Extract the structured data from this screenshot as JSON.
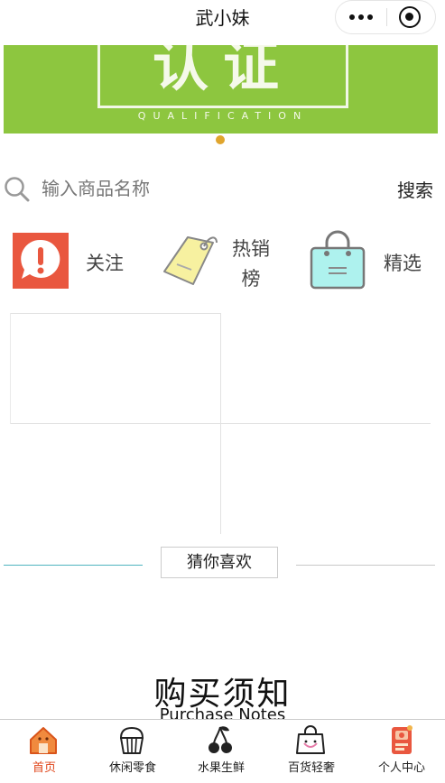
{
  "app": {
    "title": "武小妹"
  },
  "banner": {
    "big_text": "认证",
    "small_text": "QUALIFICATION"
  },
  "search": {
    "placeholder": "输入商品名称",
    "button_label": "搜索"
  },
  "categories": [
    {
      "label": "关注",
      "icon": "alert-bubble-icon"
    },
    {
      "label": "热销\n榜",
      "icon": "price-tag-icon"
    },
    {
      "label": "精选",
      "icon": "shopping-bag-icon"
    }
  ],
  "guess": {
    "label": "猜你喜欢"
  },
  "notes": {
    "title": "购买须知",
    "subtitle": "Purchase Notes"
  },
  "tabbar": {
    "items": [
      {
        "label": "首页",
        "icon": "home-icon",
        "active": true
      },
      {
        "label": "休闲零食",
        "icon": "cupcake-icon",
        "active": false
      },
      {
        "label": "水果生鲜",
        "icon": "cherry-icon",
        "active": false
      },
      {
        "label": "百货轻奢",
        "icon": "bag-icon",
        "active": false
      },
      {
        "label": "个人中心",
        "icon": "user-card-icon",
        "active": false
      }
    ]
  },
  "colors": {
    "banner_green": "#8dc63f",
    "active_tab": "#e0461b",
    "indicator": "#e0a52d",
    "divider_teal": "#4fb3bf"
  }
}
